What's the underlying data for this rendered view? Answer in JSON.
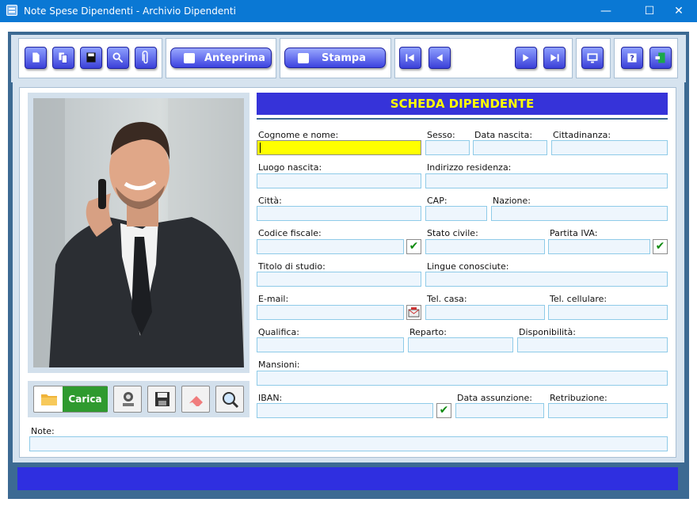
{
  "window": {
    "title": "Note Spese Dipendenti - Archivio Dipendenti",
    "minimize": "—",
    "maximize": "☐",
    "close": "✕"
  },
  "toolbar": {
    "preview_label": "Anteprima",
    "print_label": "Stampa"
  },
  "banner": {
    "title": "SCHEDA DIPENDENTE"
  },
  "photo_buttons": {
    "load_label": "Carica"
  },
  "form": {
    "cognome_nome": "Cognome e nome:",
    "sesso": "Sesso:",
    "data_nascita": "Data nascita:",
    "cittadinanza": "Cittadinanza:",
    "luogo_nascita": "Luogo nascita:",
    "indirizzo": "Indirizzo residenza:",
    "citta": "Città:",
    "cap": "CAP:",
    "nazione": "Nazione:",
    "codice_fiscale": "Codice fiscale:",
    "stato_civile": "Stato civile:",
    "partita_iva": "Partita IVA:",
    "titolo_studio": "Titolo di studio:",
    "lingue": "Lingue conosciute:",
    "email": "E-mail:",
    "tel_casa": "Tel. casa:",
    "tel_cellulare": "Tel. cellulare:",
    "qualifica": "Qualifica:",
    "reparto": "Reparto:",
    "disponibilita": "Disponibilità:",
    "mansioni": "Mansioni:",
    "iban": "IBAN:",
    "data_assunzione": "Data assunzione:",
    "retribuzione": "Retribuzione:",
    "note": "Note:"
  },
  "check_mark": "✔",
  "colors": {
    "title_bar": "#0a78d4",
    "banner": "#3633d9",
    "banner_text": "#ffff00",
    "active_field": "#ffff00",
    "frame": "#3c6a93"
  }
}
